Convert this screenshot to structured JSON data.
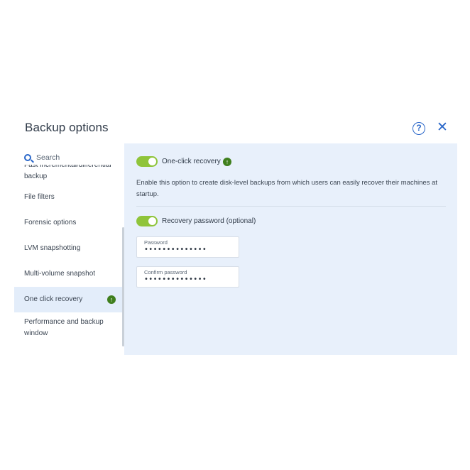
{
  "dialog": {
    "title": "Backup options",
    "help_icon": "help-circle-icon",
    "close_icon": "close-icon"
  },
  "sidebar": {
    "search_label": "Search",
    "items": [
      {
        "label": "Fast incremental/differential backup",
        "state": "partially-scrolled"
      },
      {
        "label": "File filters"
      },
      {
        "label": "Forensic options"
      },
      {
        "label": "LVM snapshotting"
      },
      {
        "label": "Multi-volume snapshot"
      },
      {
        "label": "One click recovery",
        "active": true,
        "badge_icon": "arrow-up-circle-icon"
      },
      {
        "label": "Performance and backup window"
      }
    ]
  },
  "content": {
    "one_click": {
      "toggle_on": true,
      "label": "One-click recovery",
      "badge_icon": "arrow-up-circle-icon",
      "description": "Enable this option to create disk-level backups from which users can easily recover their machines at startup."
    },
    "recovery_password": {
      "toggle_on": true,
      "label": "Recovery password (optional)"
    },
    "password_field": {
      "label": "Password",
      "value": "••••••••••••••"
    },
    "confirm_field": {
      "label": "Confirm password",
      "value": "••••••••••••••"
    }
  },
  "colors": {
    "accent": "#2a67c9",
    "toggle_on": "#8fc43a",
    "badge_green": "#3f7f1d",
    "content_bg": "#e8f0fb",
    "active_item_bg": "#e3edfa"
  }
}
